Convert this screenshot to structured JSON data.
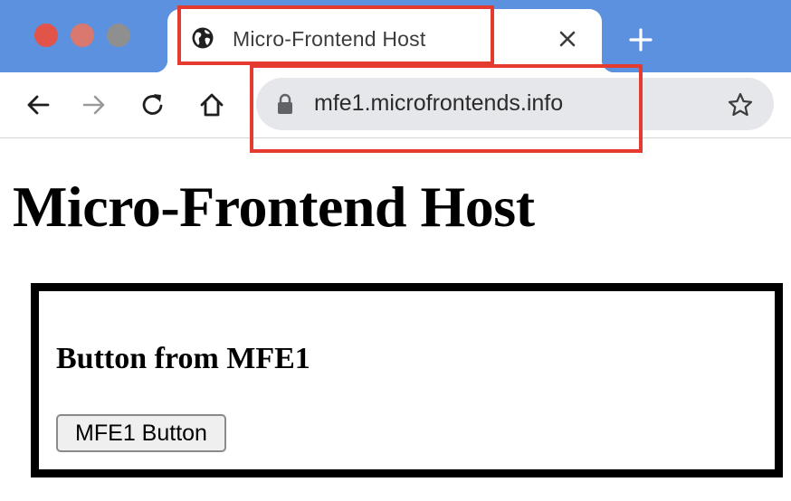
{
  "window": {
    "traffic_lights": [
      "close",
      "minimize",
      "zoom"
    ]
  },
  "tab": {
    "title": "Micro-Frontend Host",
    "favicon": "globe-icon",
    "close_icon": "close-icon"
  },
  "new_tab_icon": "plus-icon",
  "toolbar": {
    "buttons": [
      "back-arrow-icon",
      "forward-arrow-icon",
      "reload-icon",
      "home-icon"
    ],
    "url": "mfe1.microfrontends.info",
    "secure_icon": "lock-icon",
    "bookmark_icon": "star-icon"
  },
  "page": {
    "title": "Micro-Frontend Host",
    "mfe": {
      "heading": "Button from MFE1",
      "button_label": "MFE1 Button"
    }
  },
  "colors": {
    "tabstrip": "#5b91df",
    "annotation": "#e53a2f",
    "omnibox": "#e6e7ea"
  }
}
